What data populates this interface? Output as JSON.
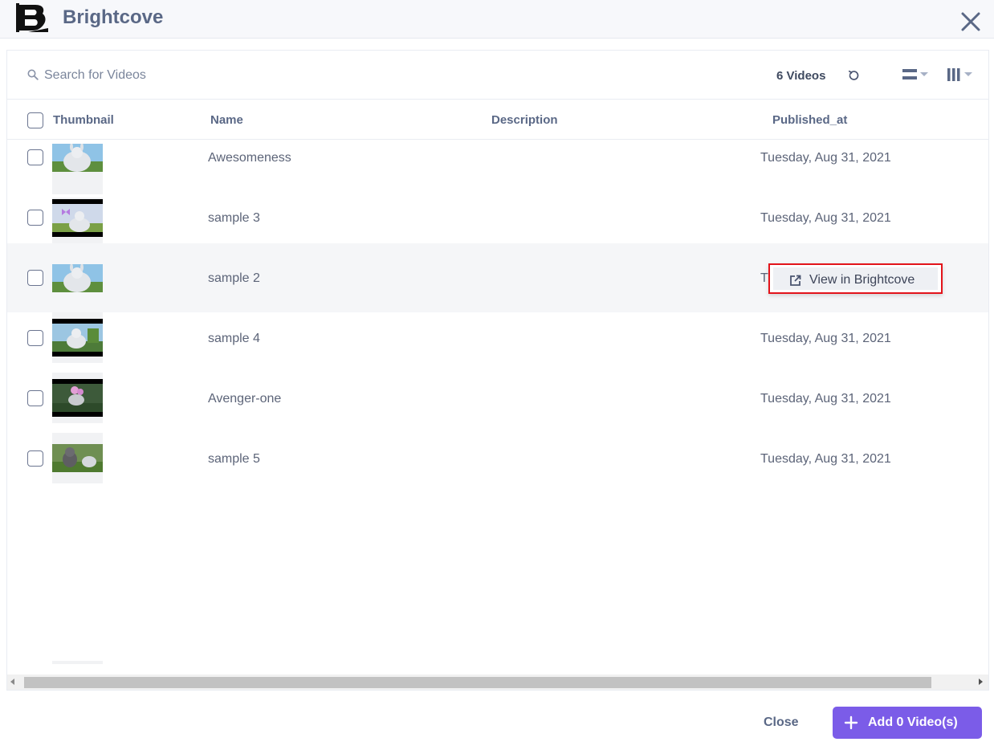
{
  "header": {
    "brand_title": "Brightcove",
    "colors": {
      "header_bg": "#f7f8fb",
      "title": "#5a6886"
    }
  },
  "toolbar": {
    "search_placeholder": "Search for Videos",
    "video_count": "6 Videos"
  },
  "table": {
    "columns": [
      "Thumbnail",
      "Name",
      "Description",
      "Published_at"
    ],
    "rows": [
      {
        "name": "Awesomeness",
        "description": "",
        "published_at": "Tuesday, Aug 31, 2021",
        "thumb": "bunny-closeup"
      },
      {
        "name": "sample 3",
        "description": "",
        "published_at": "Tuesday, Aug 31, 2021",
        "thumb": "bunny-butterfly-letterbox"
      },
      {
        "name": "sample 2",
        "description": "",
        "published_at": "T",
        "thumb": "bunny-closeup",
        "hovered": true
      },
      {
        "name": "sample 4",
        "description": "",
        "published_at": "Tuesday, Aug 31, 2021",
        "thumb": "bunny-field-letterbox"
      },
      {
        "name": "Avenger-one",
        "description": "",
        "published_at": "Tuesday, Aug 31, 2021",
        "thumb": "dark-forest-letterbox"
      },
      {
        "name": "sample 5",
        "description": "",
        "published_at": "Tuesday, Aug 31, 2021",
        "thumb": "chinchilla"
      }
    ]
  },
  "tooltip": {
    "label": "View in Brightcove",
    "icon": "external-link-icon"
  },
  "footer": {
    "close_label": "Close",
    "add_label": "Add 0 Video(s)",
    "colors": {
      "add_button": "#7b5ce8",
      "highlight_border": "#e3141b"
    }
  }
}
